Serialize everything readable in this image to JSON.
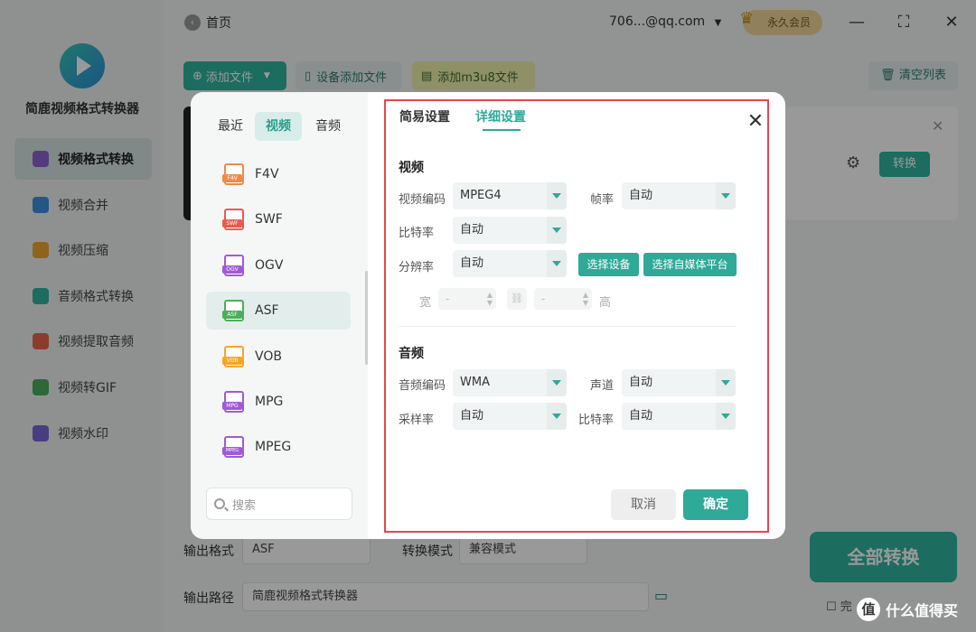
{
  "app": {
    "name": "简鹿视频格式转换器"
  },
  "sidebar": {
    "items": [
      {
        "label": "视频格式转换",
        "color": "#8a63d2"
      },
      {
        "label": "视频合并",
        "color": "#3d8fe0"
      },
      {
        "label": "视频压缩",
        "color": "#f0a531"
      },
      {
        "label": "音频格式转换",
        "color": "#2fb59f"
      },
      {
        "label": "视频提取音频",
        "color": "#e8644b"
      },
      {
        "label": "视频转GIF",
        "color": "#4cae5a"
      },
      {
        "label": "视频水印",
        "color": "#7a67d8"
      }
    ]
  },
  "topbar": {
    "home": "首页",
    "account": "706...@qq.com",
    "vip": "永久会员"
  },
  "toolbar": {
    "add_file": "添加文件",
    "device_add": "设备添加文件",
    "add_m3u8": "添加m3u8文件",
    "clear": "清空列表"
  },
  "file_card": {
    "convert": "转换"
  },
  "bottom": {
    "output_format_label": "输出格式",
    "output_format": "ASF",
    "mode_label": "转换模式",
    "mode": "兼容模式",
    "path_label": "输出路径",
    "path": "简鹿视频格式转换器",
    "convert_all": "全部转换",
    "finish_partial": "完"
  },
  "dialog": {
    "format_tabs": [
      "最近",
      "视频",
      "音频"
    ],
    "formats": [
      {
        "name": "F4V",
        "color": "#f08a4b"
      },
      {
        "name": "SWF",
        "color": "#e85a4f"
      },
      {
        "name": "OGV",
        "color": "#a05ad8"
      },
      {
        "name": "ASF",
        "color": "#4cae5a"
      },
      {
        "name": "VOB",
        "color": "#f5a623"
      },
      {
        "name": "MPG",
        "color": "#a05ad8"
      },
      {
        "name": "MPEG",
        "color": "#a05ad8"
      }
    ],
    "search_placeholder": "搜索",
    "settings_tabs": [
      "简易设置",
      "详细设置"
    ],
    "video_section": "视频",
    "video": {
      "codec_label": "视频编码",
      "codec": "MPEG4",
      "framerate_label": "帧率",
      "framerate": "自动",
      "bitrate_label": "比特率",
      "bitrate": "自动",
      "resolution_label": "分辨率",
      "resolution": "自动",
      "select_device": "选择设备",
      "select_platform": "选择自媒体平台",
      "width_label": "宽",
      "width": "-",
      "height_label": "高",
      "height": "-"
    },
    "audio_section": "音频",
    "audio": {
      "codec_label": "音频编码",
      "codec": "WMA",
      "channel_label": "声道",
      "channel": "自动",
      "samplerate_label": "采样率",
      "samplerate": "自动",
      "bitrate_label": "比特率",
      "bitrate": "自动"
    },
    "cancel": "取消",
    "confirm": "确定"
  },
  "watermark": "什么值得买"
}
